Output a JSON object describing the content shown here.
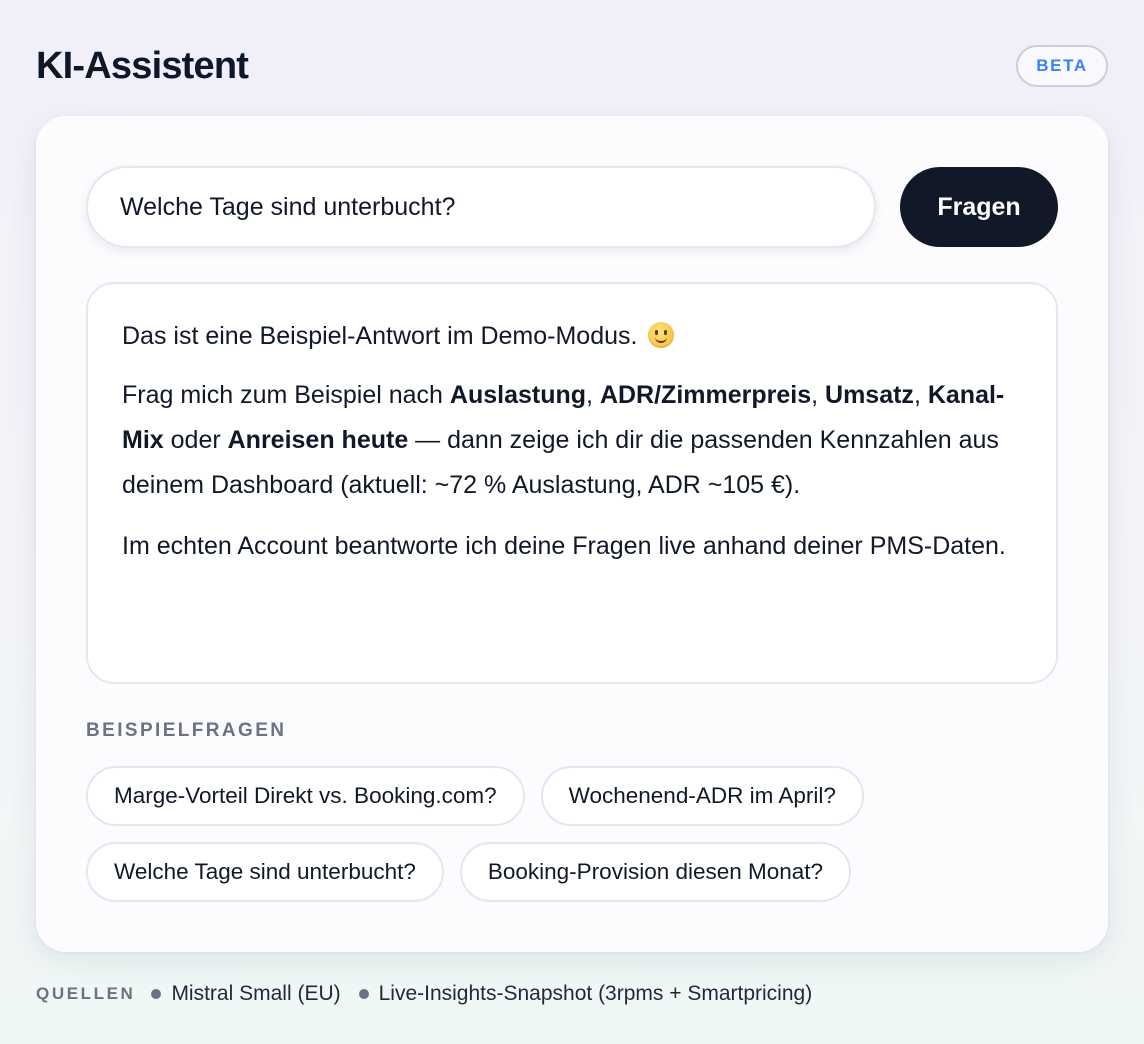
{
  "header": {
    "title": "KI-Assistent",
    "badge": "BETA"
  },
  "ask": {
    "input_value": "Welche Tage sind unterbucht?",
    "button_label": "Fragen"
  },
  "answer": {
    "p1": "Das ist eine Beispiel-Antwort im Demo-Modus.",
    "p1_emoji": "slightly-smiling-face-icon",
    "p2": {
      "t1": "Frag mich zum Beispiel nach ",
      "b1": "Auslastung",
      "t2": ", ",
      "b2": "ADR/Zimmerpreis",
      "t3": ", ",
      "b3": "Umsatz",
      "t4": ", ",
      "b4": "Kanal-Mix",
      "t5": " oder ",
      "b5": "Anreisen heute",
      "t6": " — dann zeige ich dir die passenden Kennzahlen aus deinem Dashboard (aktuell: ~72 % Auslastung, ADR ~105 €)."
    },
    "p3": "Im echten Account beantworte ich deine Fragen live anhand deiner PMS-Daten."
  },
  "examples": {
    "label": "BEISPIELFRAGEN",
    "items": [
      "Marge-Vorteil Direkt vs. Booking.com?",
      "Wochenend-ADR im April?",
      "Welche Tage sind unterbucht?",
      "Booking-Provision diesen Monat?"
    ]
  },
  "sources": {
    "label": "QUELLEN",
    "items": [
      "Mistral Small (EU)",
      "Live-Insights-Snapshot (3rpms + Smartpricing)"
    ]
  }
}
